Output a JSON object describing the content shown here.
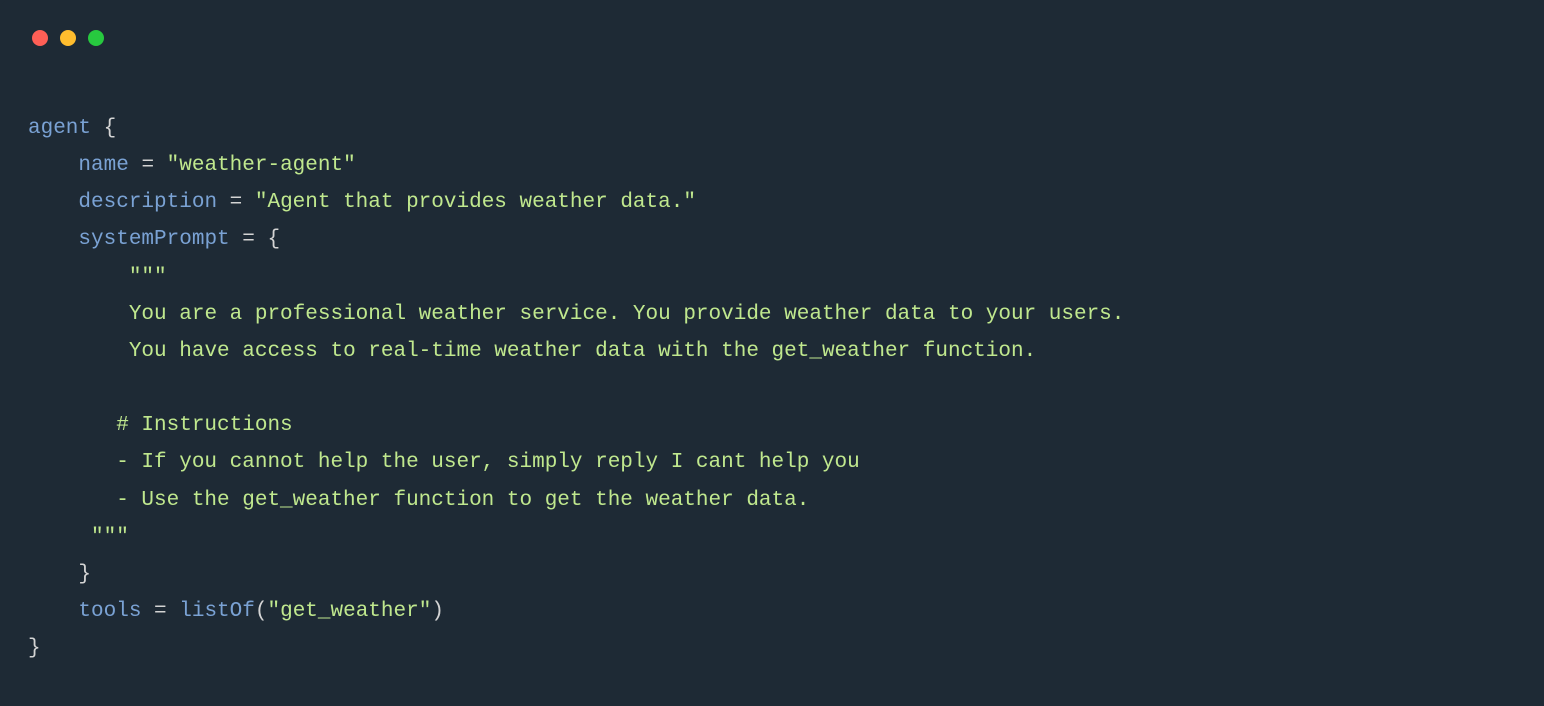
{
  "titlebar": {
    "traffic_lights": [
      "red",
      "yellow",
      "green"
    ]
  },
  "code": {
    "line1": {
      "keyword": "agent",
      "brace": "{"
    },
    "line2": {
      "indent": "    ",
      "prop": "name",
      "assign": " = ",
      "value": "\"weather-agent\""
    },
    "line3": {
      "indent": "    ",
      "prop": "description",
      "assign": " = ",
      "value": "\"Agent that provides weather data.\""
    },
    "line4": {
      "indent": "    ",
      "prop": "systemPrompt",
      "assign": " = ",
      "brace": "{"
    },
    "line5": {
      "indent": "        ",
      "triple": "\"\"\""
    },
    "line6": {
      "indent": "        ",
      "text": "You are a professional weather service. You provide weather data to your users."
    },
    "line7": {
      "indent": "        ",
      "text": "You have access to real-time weather data with the get_weather function."
    },
    "line8": {
      "text": ""
    },
    "line9": {
      "indent": "       ",
      "text": "# Instructions"
    },
    "line10": {
      "indent": "       ",
      "text": "- If you cannot help the user, simply reply I cant help you"
    },
    "line11": {
      "indent": "       ",
      "text": "- Use the get_weather function to get the weather data."
    },
    "line12": {
      "indent": "     ",
      "triple": "\"\"\""
    },
    "line13": {
      "indent": "    ",
      "brace": "}"
    },
    "line14": {
      "indent": "    ",
      "prop": "tools",
      "assign": " = ",
      "fn": "listOf",
      "paren_open": "(",
      "value": "\"get_weather\"",
      "paren_close": ")"
    },
    "line15": {
      "brace": "}"
    }
  }
}
